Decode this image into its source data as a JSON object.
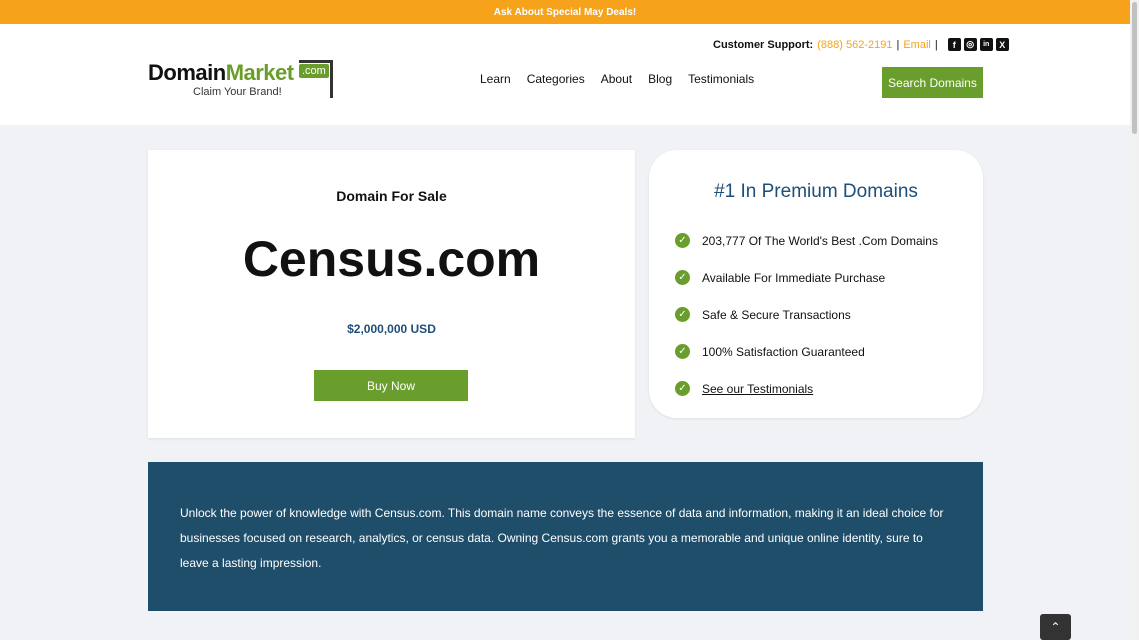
{
  "topbar": {
    "text": "Ask About Special May Deals!"
  },
  "header": {
    "logo": {
      "part1": "Domain",
      "part2": "Market",
      "com": ".com",
      "tagline": "Claim Your Brand!"
    },
    "support": {
      "label": "Customer Support:",
      "phone": "(888) 562-2191",
      "email": "Email"
    },
    "social": [
      {
        "icon": "facebook-icon",
        "glyph": "f"
      },
      {
        "icon": "instagram-icon",
        "glyph": "◎"
      },
      {
        "icon": "linkedin-icon",
        "glyph": "in"
      },
      {
        "icon": "x-icon",
        "glyph": "X"
      }
    ],
    "nav": [
      "Learn",
      "Categories",
      "About",
      "Blog",
      "Testimonials"
    ],
    "search_button": "Search Domains"
  },
  "listing": {
    "label": "Domain For Sale",
    "domain": "Census.com",
    "price": "$2,000,000 USD",
    "buy_button": "Buy Now"
  },
  "premium": {
    "title": "#1 In Premium Domains",
    "features": [
      "203,777 Of The World's Best .Com Domains",
      "Available For Immediate Purchase",
      "Safe & Secure Transactions",
      "100% Satisfaction Guaranteed",
      "See our Testimonials"
    ]
  },
  "description": "Unlock the power of knowledge with Census.com. This domain name conveys the essence of data and information, making it an ideal choice for businesses focused on research, analytics, or census data. Owning Census.com grants you a memorable and unique online identity, sure to leave a lasting impression.",
  "scroll_top": {
    "icon": "chevron-up-icon",
    "glyph": "⌃"
  },
  "colors": {
    "accent": "#f7a21b",
    "green": "#6a9e2c",
    "navy": "#1f4e6b"
  }
}
